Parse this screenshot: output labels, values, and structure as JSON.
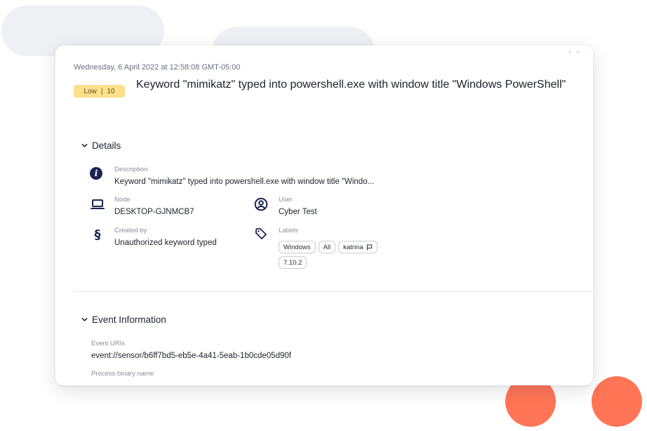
{
  "alert": {
    "timestamp": "Wednesday, 6 April 2022 at 12:58:08 GMT-05:00",
    "severity_label": "Low",
    "severity_separator": "|",
    "severity_score": "10",
    "title": "Keyword \"mimikatz\" typed into powershell.exe with window title \"Windows PowerShell\""
  },
  "details": {
    "header": "Details",
    "description": {
      "label": "Description",
      "value": "Keyword \"mimikatz\" typed into powershell.exe with window title \"Windo..."
    },
    "node": {
      "label": "Node",
      "value": "DESKTOP-GJNMCB7"
    },
    "user": {
      "label": "User",
      "value": "Cyber Test"
    },
    "created_by": {
      "label": "Created by",
      "value": "Unauthorized keyword typed"
    },
    "labels": {
      "label": "Labels",
      "tags": [
        "Windows",
        "All",
        "katrina",
        "7.10.2"
      ]
    }
  },
  "event_information": {
    "header": "Event Information",
    "event_uris": {
      "label": "Event URIs",
      "value": "event://sensor/b6ff7bd5-eb5e-4a41-5eab-1b0cde05d90f"
    },
    "process_binary_name": {
      "label": "Process binary name"
    }
  },
  "colors": {
    "severity_low_bg": "#fde08a",
    "icon_navy": "#1c2452",
    "accent_coral": "#ff7556"
  },
  "icons": [
    "expand-icon",
    "chevron-down-icon",
    "info-icon",
    "laptop-icon",
    "user-circle-icon",
    "section-sign-icon",
    "tag-icon",
    "flag-icon"
  ]
}
